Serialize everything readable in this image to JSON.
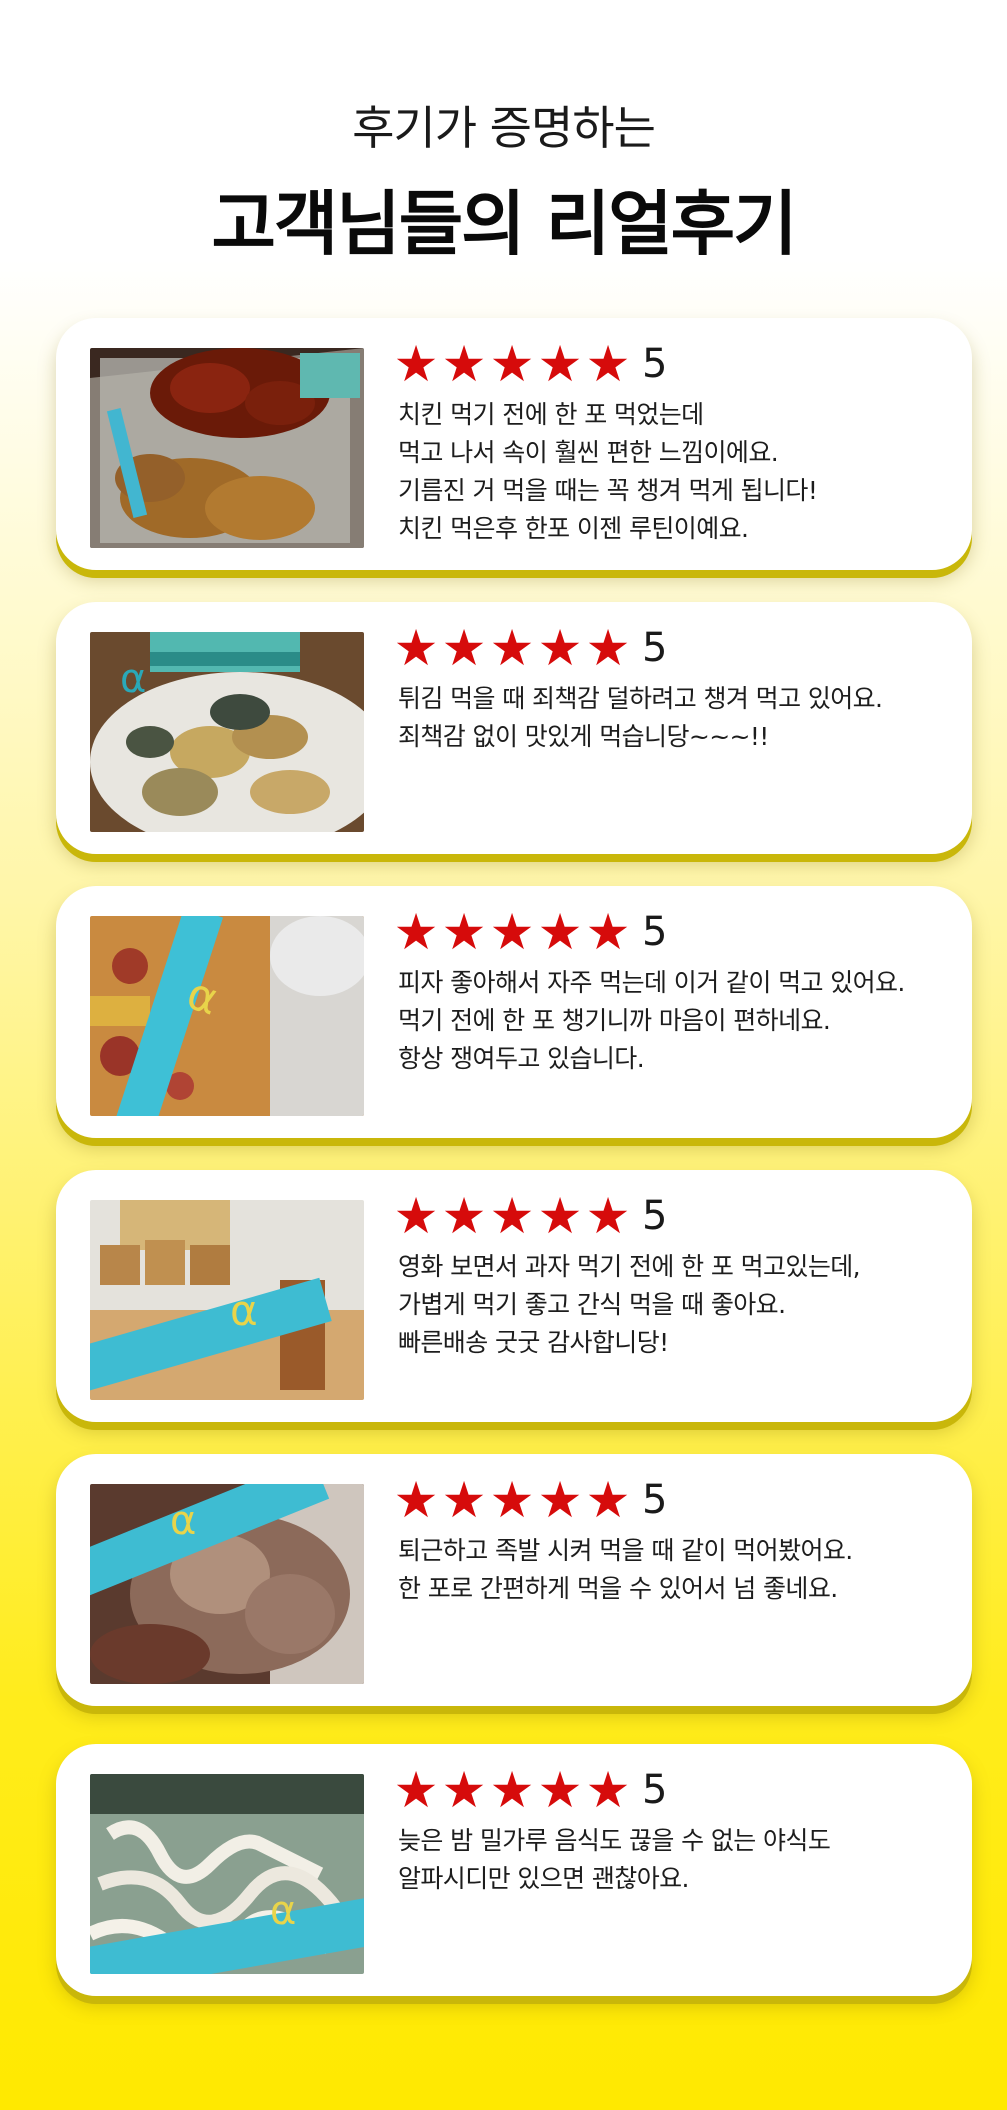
{
  "header": {
    "subtitle": "후기가 증명하는",
    "title": "고객님들의 리얼후기"
  },
  "colors": {
    "star": "#d60b0b",
    "background_top": "#ffffff",
    "background_bottom": "#ffe900"
  },
  "reviews": [
    {
      "stars": 5,
      "score": "5",
      "photo": "chicken-with-stick",
      "lines": [
        "치킨 먹기 전에 한 포 먹었는데",
        "먹고 나서 속이 훨씬 편한 느낌이에요.",
        "기름진 거 먹을 때는 꼭 챙겨 먹게 됩니다!",
        "치킨 먹은후 한포 이젠 루틴이예요."
      ]
    },
    {
      "stars": 5,
      "score": "5",
      "photo": "tempura-with-box",
      "lines": [
        "튀김 먹을 때 죄책감 덜하려고 챙겨 먹고 있어요.",
        "죄책감 없이 맛있게 먹습니당~~~!!"
      ]
    },
    {
      "stars": 5,
      "score": "5",
      "photo": "pizza-with-stick",
      "lines": [
        "피자 좋아해서 자주 먹는데 이거 같이 먹고 있어요.",
        "먹기 전에 한 포 챙기니까 마음이 편하네요.",
        "항상 쟁여두고 있습니다."
      ]
    },
    {
      "stars": 5,
      "score": "5",
      "photo": "snacks-with-stick",
      "lines": [
        "영화 보면서 과자 먹기 전에 한 포 먹고있는데,",
        "가볍게 먹기 좋고 간식 먹을 때 좋아요.",
        "빠른배송 굿굿 감사합니당!"
      ]
    },
    {
      "stars": 5,
      "score": "5",
      "photo": "jokbal-with-stick",
      "lines": [
        "퇴근하고 족발 시켜 먹을 때 같이 먹어봤어요.",
        "한 포로 간편하게 먹을 수 있어서 넘 좋네요."
      ]
    },
    {
      "stars": 5,
      "score": "5",
      "photo": "noodles-with-stick",
      "lines": [
        "늦은 밤 밀가루 음식도 끊을 수 없는 야식도",
        "알파시디만 있으면 괜찮아요."
      ]
    }
  ]
}
